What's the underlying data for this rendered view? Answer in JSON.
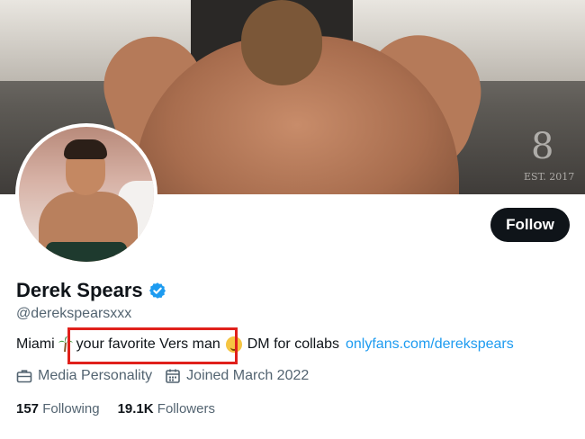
{
  "banner": {
    "alt_text": "banner photo",
    "est_label": "EST. 2017",
    "digit": "8"
  },
  "profile": {
    "display_name": "Derek Spears",
    "handle": "@derekspearsxxx",
    "verified": true,
    "follow_label": "Follow"
  },
  "bio": {
    "prefix": "Miami",
    "highlighted": "your favorite Vers man",
    "suffix": "DM for collabs",
    "link": "onlyfans.com/derekspears",
    "palm_icon": "palm-tree-emoji",
    "smile_icon": "smiling-face-emoji"
  },
  "meta": {
    "category": "Media Personality",
    "category_icon": "briefcase-icon",
    "joined": "Joined March 2022",
    "joined_icon": "calendar-icon"
  },
  "stats": {
    "following_count": "157",
    "following_label": "Following",
    "followers_count": "19.1K",
    "followers_label": "Followers"
  },
  "colors": {
    "link": "#1d9bf0",
    "verified": "#1d9bf0",
    "highlight_box": "#e0201b",
    "button_bg": "#0f1419",
    "secondary_text": "#536471"
  }
}
